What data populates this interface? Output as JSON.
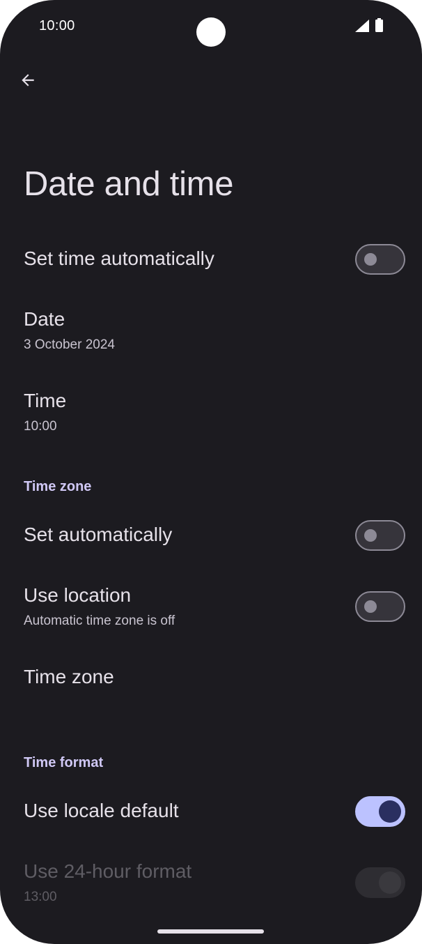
{
  "status_bar": {
    "time": "10:00"
  },
  "header": {
    "back_icon": "arrow-back-icon",
    "title": "Date and time"
  },
  "rows": {
    "set_time_auto": {
      "title": "Set time automatically",
      "toggle": "off"
    },
    "date": {
      "title": "Date",
      "value": "3 October 2024"
    },
    "time": {
      "title": "Time",
      "value": "10:00"
    },
    "tz_set_auto": {
      "title": "Set automatically",
      "toggle": "off"
    },
    "use_location": {
      "title": "Use location",
      "summary": "Automatic time zone is off",
      "toggle": "off"
    },
    "time_zone": {
      "title": "Time zone"
    },
    "use_locale_default": {
      "title": "Use locale default",
      "toggle": "on"
    },
    "use_24_hour": {
      "title": "Use 24-hour format",
      "value": "13:00",
      "toggle": "on",
      "enabled": false
    }
  },
  "sections": {
    "time_zone": "Time zone",
    "time_format": "Time format"
  },
  "colors": {
    "background": "#1c1b20",
    "accent": "#bcc2ff",
    "section_header": "#d0c8f5"
  }
}
